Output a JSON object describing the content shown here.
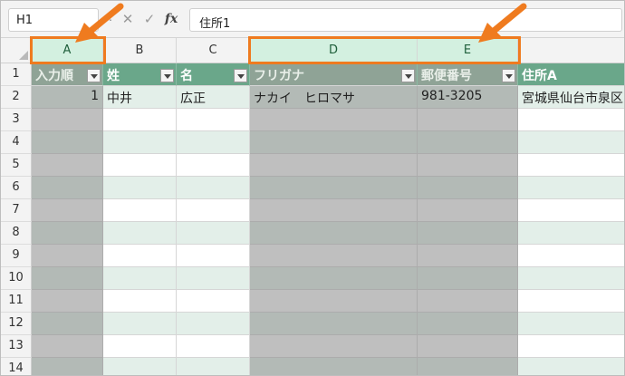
{
  "formula_bar": {
    "name_box": "H1",
    "options_glyph": "⋮",
    "cancel_icon": "✕",
    "enter_icon": "✓",
    "fx_label": "fx",
    "formula": "住所1"
  },
  "columns": [
    "A",
    "B",
    "C",
    "D",
    "E"
  ],
  "rows": [
    "1",
    "2",
    "3",
    "4",
    "5",
    "6",
    "7",
    "8",
    "9",
    "10",
    "11",
    "12",
    "13",
    "14"
  ],
  "table_headers": {
    "a": "入力順",
    "b": "姓",
    "c": "名",
    "d": "フリガナ",
    "e": "郵便番号",
    "f": "住所A"
  },
  "row2": {
    "a": "1",
    "b": "中井",
    "c": "広正",
    "d": "ナカイ　ヒロマサ",
    "e": "981-3205",
    "f": "宮城県仙台市泉区"
  },
  "colors": {
    "table_header": "#6aa78a",
    "band": "#e3efe9",
    "selected_column": "#bfbfbf",
    "highlight": "#ef7b1f"
  }
}
